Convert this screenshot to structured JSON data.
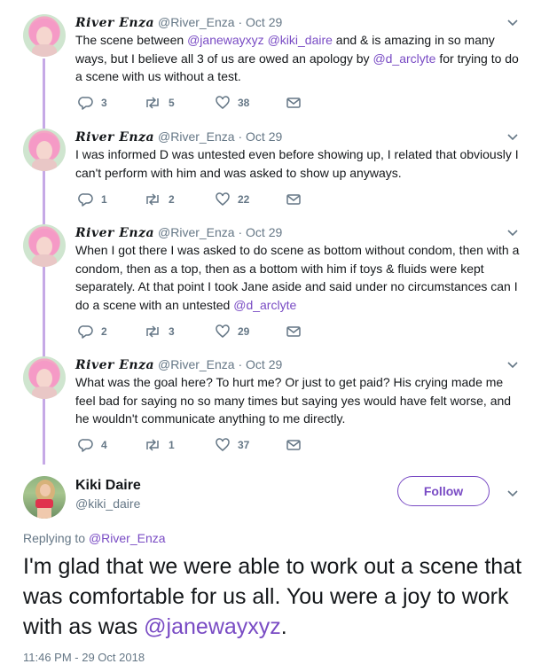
{
  "thread": [
    {
      "name": "River Enza",
      "handle": "@River_Enza",
      "sep": "·",
      "date": "Oct 29",
      "segments": [
        {
          "t": "The scene between ",
          "m": false
        },
        {
          "t": "@janewayxyz",
          "m": true
        },
        {
          "t": " ",
          "m": false
        },
        {
          "t": "@kiki_daire",
          "m": true
        },
        {
          "t": " and & is amazing in so many ways, but I believe all 3 of us are owed an apology by ",
          "m": false
        },
        {
          "t": "@d_arclyte",
          "m": true
        },
        {
          "t": " for trying to do a scene with us without a test.",
          "m": false
        }
      ],
      "replies": "3",
      "retweets": "5",
      "likes": "38"
    },
    {
      "name": "River Enza",
      "handle": "@River_Enza",
      "sep": "·",
      "date": "Oct 29",
      "segments": [
        {
          "t": "I was informed D was untested even before showing up, I related that obviously I can't perform with him and was asked to show up anyways.",
          "m": false
        }
      ],
      "replies": "1",
      "retweets": "2",
      "likes": "22"
    },
    {
      "name": "River Enza",
      "handle": "@River_Enza",
      "sep": "·",
      "date": "Oct 29",
      "segments": [
        {
          "t": "When I got there I was asked to do scene as bottom without condom, then with a condom, then as a top, then as a bottom with him if toys & fluids were kept separately. At that point I took Jane aside and said under no circumstances can I do a scene with an untested ",
          "m": false
        },
        {
          "t": "@d_arclyte",
          "m": true
        }
      ],
      "replies": "2",
      "retweets": "3",
      "likes": "29"
    },
    {
      "name": "River Enza",
      "handle": "@River_Enza",
      "sep": "·",
      "date": "Oct 29",
      "segments": [
        {
          "t": "What was the goal here? To hurt me? Or just to get paid? His crying made me feel bad for saying no so many times but saying yes would have felt worse, and he wouldn't  communicate anything to me directly.",
          "m": false
        }
      ],
      "replies": "4",
      "retweets": "1",
      "likes": "37"
    }
  ],
  "main": {
    "name": "Kiki Daire",
    "handle": "@kiki_daire",
    "follow_label": "Follow",
    "replying_prefix": "Replying to ",
    "replying_to": "@River_Enza",
    "text_before": "I'm glad that we were able to work out a scene that was comfortable for us all. You were a joy to work with as was ",
    "text_mention": "@janewayxyz",
    "text_after": ".",
    "timestamp": "11:46 PM - 29 Oct 2018"
  },
  "colors": {
    "accent": "#794bc4",
    "thread_line": "#c6a9e6",
    "secondary_text": "#657786"
  },
  "icons": [
    "reply-icon",
    "retweet-icon",
    "like-icon",
    "direct-message-icon",
    "chevron-down-icon"
  ]
}
